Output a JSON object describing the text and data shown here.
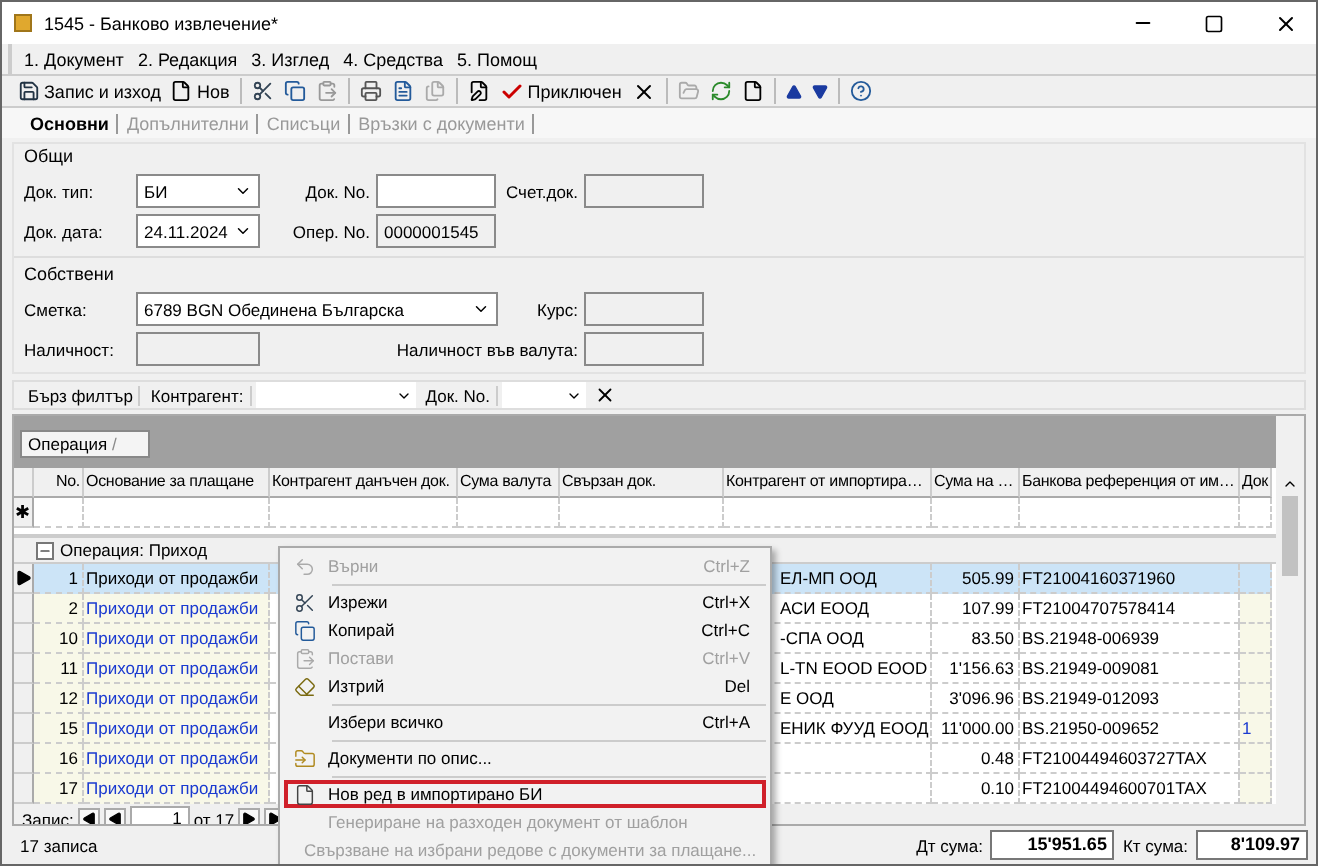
{
  "window": {
    "title": "1545 - Банково извлечение*"
  },
  "menu": [
    "1. Документ",
    "2. Редакция",
    "3. Изглед",
    "4. Средства",
    "5. Помощ"
  ],
  "toolbar": {
    "save": "Запис и изход",
    "new": "Нов",
    "close_doc": "Приключен"
  },
  "tabs": [
    {
      "label": "Основни",
      "selected": true
    },
    {
      "label": "Допълнителни",
      "selected": false
    },
    {
      "label": "Списъци",
      "selected": false
    },
    {
      "label": "Връзки с документи",
      "selected": false
    }
  ],
  "general": {
    "title": "Общи",
    "doc_type_label": "Док. тип:",
    "doc_type": "БИ",
    "doc_no_label": "Док. No.",
    "account_doc_label": "Счет.док.",
    "doc_date_label": "Док. дата:",
    "doc_date": "24.11.2024",
    "oper_no_label": "Опер. No.",
    "oper_no": "0000001545"
  },
  "own": {
    "title": "Собствени",
    "account_label": "Сметка:",
    "account": "6789 BGN Обединена Българска",
    "rate_label": "Курс:",
    "balance_label": "Наличност:",
    "balance_currency_label": "Наличност във валута:"
  },
  "filter": {
    "title": "Бърз филтър",
    "contractor_label": "Контрагент:",
    "doc_no_label": "Док. No."
  },
  "grouping": {
    "label": "Операция",
    "sort_mark": "/"
  },
  "new_row_mark": "✱",
  "columns": [
    "No.",
    "Основание за плащане",
    "Контрагент данъчен док.",
    "Сума валута",
    "Свързан док.",
    "Контрагент от импортира…",
    "Сума на …",
    "Банкова референция от им…",
    "Док"
  ],
  "group": {
    "label": "Операция: Приход",
    "expanded": true
  },
  "rows": [
    {
      "no": "1",
      "basis": "Приходи от продажби",
      "contractor": "ЕЛ-МП ООД",
      "amount": "505.99",
      "ref": "FT21004160371960",
      "selected": true
    },
    {
      "no": "2",
      "basis": "Приходи от продажби",
      "contractor": "АСИ ЕООД",
      "amount": "107.99",
      "ref": "FT21004707578414",
      "selected": false
    },
    {
      "no": "10",
      "basis": "Приходи от продажби",
      "contractor": "-СПА ООД",
      "amount": "83.50",
      "ref": "BS.21948-006939",
      "selected": false
    },
    {
      "no": "11",
      "basis": "Приходи от продажби",
      "contractor": "L-TN EOOD EOOD",
      "amount": "1'156.63",
      "ref": "BS.21949-009081",
      "selected": false
    },
    {
      "no": "12",
      "basis": "Приходи от продажби",
      "contractor": "Е ООД",
      "amount": "3'096.96",
      "ref": "BS.21949-012093",
      "selected": false
    },
    {
      "no": "15",
      "basis": "Приходи от продажби",
      "contractor": "ЕНИК ФУУД ЕООД",
      "amount": "11'000.00",
      "ref": "BS.21950-009652",
      "doc": "1",
      "selected": false
    },
    {
      "no": "16",
      "basis": "Приходи от продажби",
      "amount": "0.48",
      "ref": "FT21004494603727TAX",
      "selected": false
    },
    {
      "no": "17",
      "basis": "Приходи от продажби",
      "amount": "0.10",
      "ref": "FT21004494600701TAX",
      "selected": false
    }
  ],
  "navigator": {
    "label": "Запис:",
    "current": "1",
    "total": "от 17"
  },
  "status": {
    "count": "17 записа",
    "debit_label": "Дт сума:",
    "debit": "15'951.65",
    "credit_label": "Кт сума:",
    "credit": "8'109.97"
  },
  "context_menu": [
    {
      "kind": "item",
      "label": "Върни",
      "shortcut": "Ctrl+Z",
      "disabled": true,
      "highlighted": false
    },
    {
      "kind": "separator"
    },
    {
      "kind": "item",
      "label": "Изрежи",
      "shortcut": "Ctrl+X",
      "disabled": false,
      "highlighted": false
    },
    {
      "kind": "item",
      "label": "Копирай",
      "shortcut": "Ctrl+C",
      "disabled": false,
      "highlighted": false
    },
    {
      "kind": "item",
      "label": "Постави",
      "shortcut": "Ctrl+V",
      "disabled": true,
      "highlighted": false
    },
    {
      "kind": "item",
      "label": "Изтрий",
      "shortcut": "Del",
      "disabled": false,
      "highlighted": false
    },
    {
      "kind": "separator"
    },
    {
      "kind": "item",
      "label": "Избери всичко",
      "shortcut": "Ctrl+A",
      "disabled": false,
      "highlighted": false
    },
    {
      "kind": "separator"
    },
    {
      "kind": "item",
      "label": "Документи по опис...",
      "disabled": false,
      "highlighted": false
    },
    {
      "kind": "separator"
    },
    {
      "kind": "item",
      "label": "Нов ред в импортирано БИ",
      "disabled": false,
      "highlighted": true
    },
    {
      "kind": "item",
      "label": "Генериране на разходен документ от шаблон",
      "disabled": true,
      "highlighted": false
    },
    {
      "kind": "item",
      "label": "Свързване на избрани редове с документи за плащане...",
      "disabled": true,
      "highlighted": false
    }
  ]
}
